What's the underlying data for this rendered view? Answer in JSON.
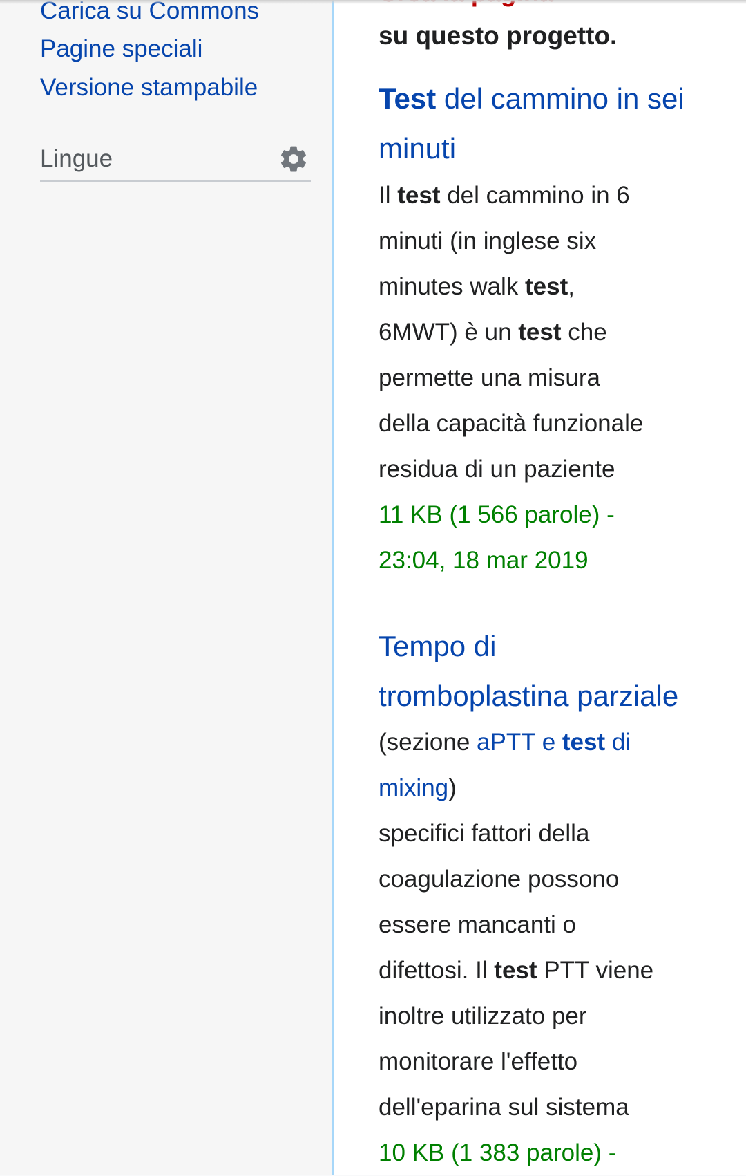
{
  "sidebar": {
    "links": [
      {
        "label": "Carica su Commons"
      },
      {
        "label": "Pagine speciali"
      },
      {
        "label": "Versione stampabile"
      }
    ],
    "languages_label": "Lingue",
    "languages_icon": "gear-icon"
  },
  "main": {
    "notice_partial": "Crea la pagina",
    "notice_tail": "su questo progetto.",
    "results": [
      {
        "title_bold": "Test",
        "title_line1_rest": " del cammino in sei",
        "title_line2": "minuti",
        "snippet": [
          [
            "Il ",
            "test",
            " del cammino in 6"
          ],
          [
            "minuti (in inglese six"
          ],
          [
            "minutes walk ",
            "test",
            ","
          ],
          [
            "6MWT) è un ",
            "test",
            " che"
          ],
          [
            "permette una misura"
          ],
          [
            "della capacità funzionale"
          ],
          [
            "residua di un paziente"
          ]
        ],
        "meta_line1": "11 KB (1 566 parole) -",
        "meta_line2": "23:04, 18 mar 2019"
      },
      {
        "title_line1": "Tempo di",
        "title_line2": "tromboplastina parziale",
        "section_prefix": "(sezione ",
        "section_link_a": "aPTT e ",
        "section_link_bold": "test",
        "section_link_b": " di",
        "section_link_c": "mixing",
        "section_suffix": ")",
        "snippet": [
          [
            "specifici fattori della"
          ],
          [
            "coagulazione possono"
          ],
          [
            "essere mancanti o"
          ],
          [
            "difettosi. Il ",
            "test",
            " PTT viene"
          ],
          [
            "inoltre utilizzato per"
          ],
          [
            "monitorare l'effetto"
          ],
          [
            "dell'eparina sul sistema"
          ]
        ],
        "meta_line1": "10 KB (1 383 parole) -"
      }
    ]
  }
}
